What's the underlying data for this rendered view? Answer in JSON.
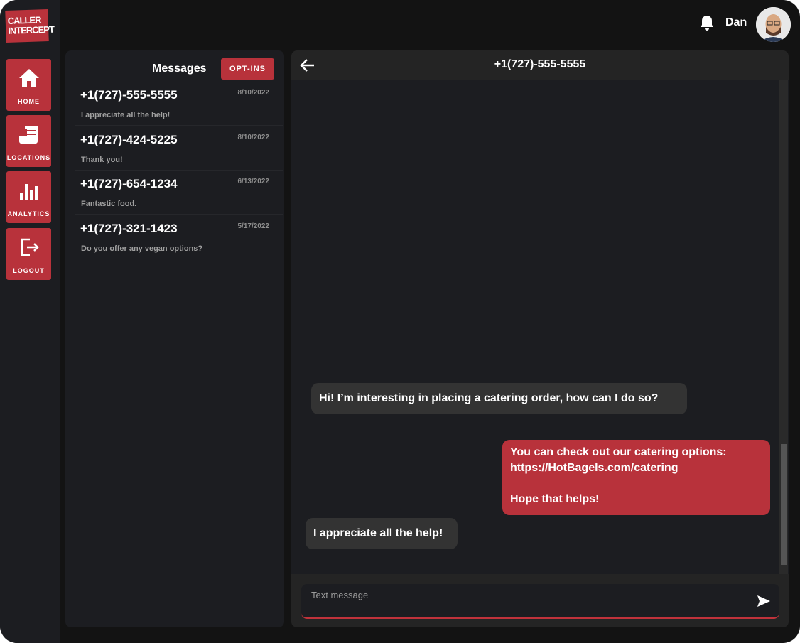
{
  "app": {
    "logo_text": "CALLER INTERCEPT",
    "user_name": "Dan",
    "accent": "#b8323b"
  },
  "nav": [
    {
      "label": "HOME",
      "icon": "home-icon"
    },
    {
      "label": "LOCATIONS",
      "icon": "receipt-icon"
    },
    {
      "label": "ANALYTICS",
      "icon": "bar-chart-icon"
    },
    {
      "label": "LOGOUT",
      "icon": "logout-icon"
    }
  ],
  "messages": {
    "title": "Messages",
    "optins_label": "OPT-INS",
    "items": [
      {
        "phone": "+1(727)-555-5555",
        "date": "8/10/2022",
        "preview": "I appreciate all the help!"
      },
      {
        "phone": "+1(727)-424-5225",
        "date": "8/10/2022",
        "preview": "Thank you!"
      },
      {
        "phone": "+1(727)-654-1234",
        "date": "6/13/2022",
        "preview": "Fantastic food."
      },
      {
        "phone": "+1(727)-321-1423",
        "date": "5/17/2022",
        "preview": "Do you offer any vegan options?"
      }
    ]
  },
  "chat": {
    "title": "+1(727)-555-5555",
    "bubbles": [
      {
        "from": "them",
        "text": "Hi! I’m interesting in placing a catering order, how can I do so?"
      },
      {
        "from": "me",
        "text": "You can check out our catering options:\nhttps://HotBagels.com/catering\n\nHope that helps!"
      },
      {
        "from": "them",
        "text": "I appreciate all the help!"
      }
    ],
    "input_placeholder": "Text message"
  }
}
